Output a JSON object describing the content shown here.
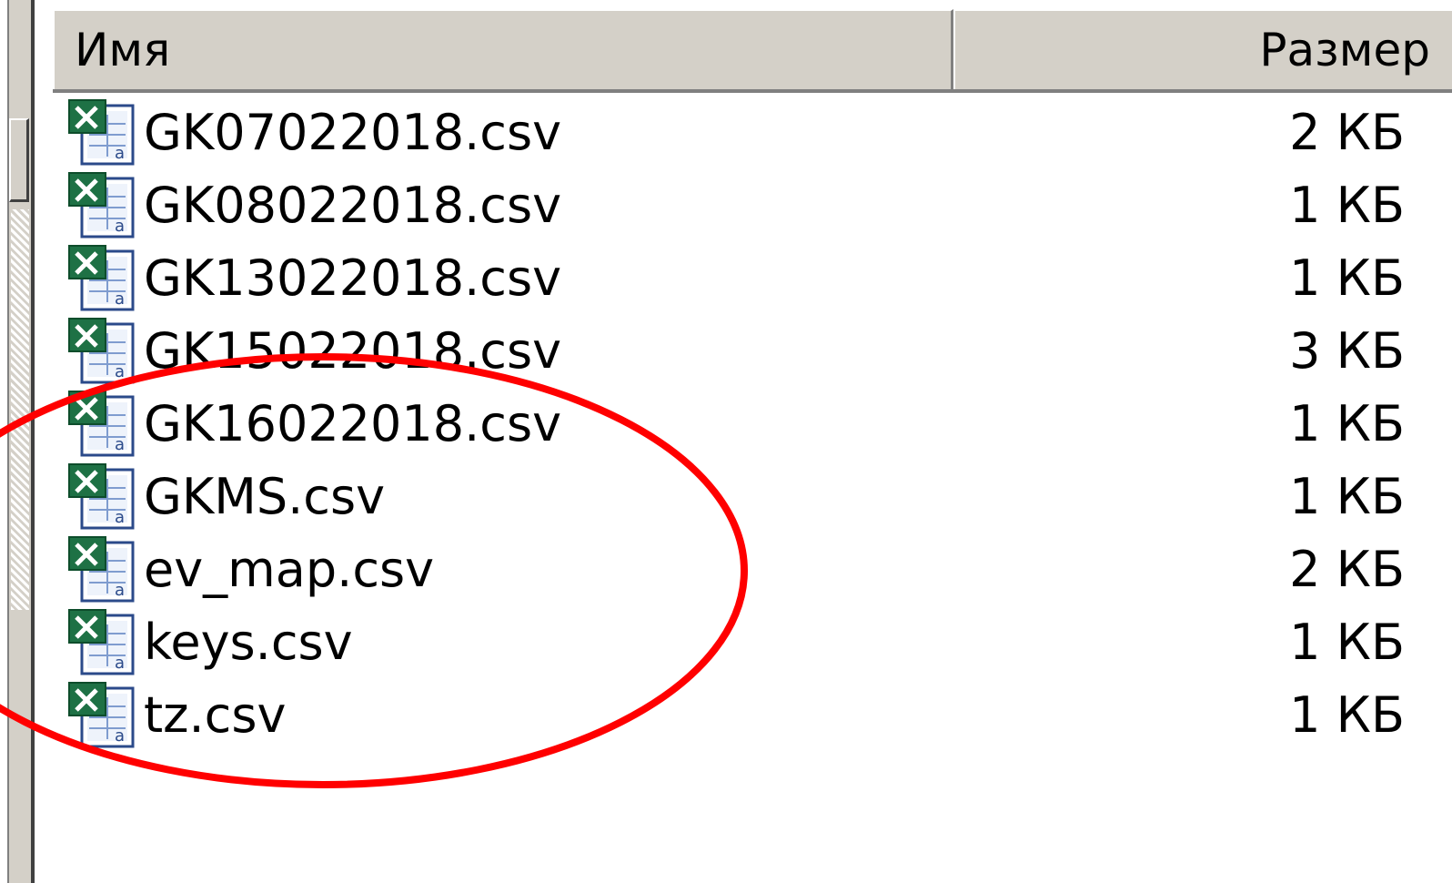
{
  "columns": {
    "name": "Имя",
    "size": "Размер"
  },
  "files": [
    {
      "name": "GK07022018.csv",
      "size": "2 КБ",
      "icon": "excel-csv-icon"
    },
    {
      "name": "GK08022018.csv",
      "size": "1 КБ",
      "icon": "excel-csv-icon"
    },
    {
      "name": "GK13022018.csv",
      "size": "1 КБ",
      "icon": "excel-csv-icon"
    },
    {
      "name": "GK15022018.csv",
      "size": "3 КБ",
      "icon": "excel-csv-icon"
    },
    {
      "name": "GK16022018.csv",
      "size": "1 КБ",
      "icon": "excel-csv-icon"
    },
    {
      "name": "GKMS.csv",
      "size": "1 КБ",
      "icon": "excel-csv-icon"
    },
    {
      "name": "ev_map.csv",
      "size": "2 КБ",
      "icon": "excel-csv-icon"
    },
    {
      "name": "keys.csv",
      "size": "1 КБ",
      "icon": "excel-csv-icon"
    },
    {
      "name": "tz.csv",
      "size": "1 КБ",
      "icon": "excel-csv-icon"
    }
  ],
  "colors": {
    "header_bg": "#d4d0c8",
    "annotation_circle": "#ff0000",
    "excel_green": "#1e7145"
  }
}
